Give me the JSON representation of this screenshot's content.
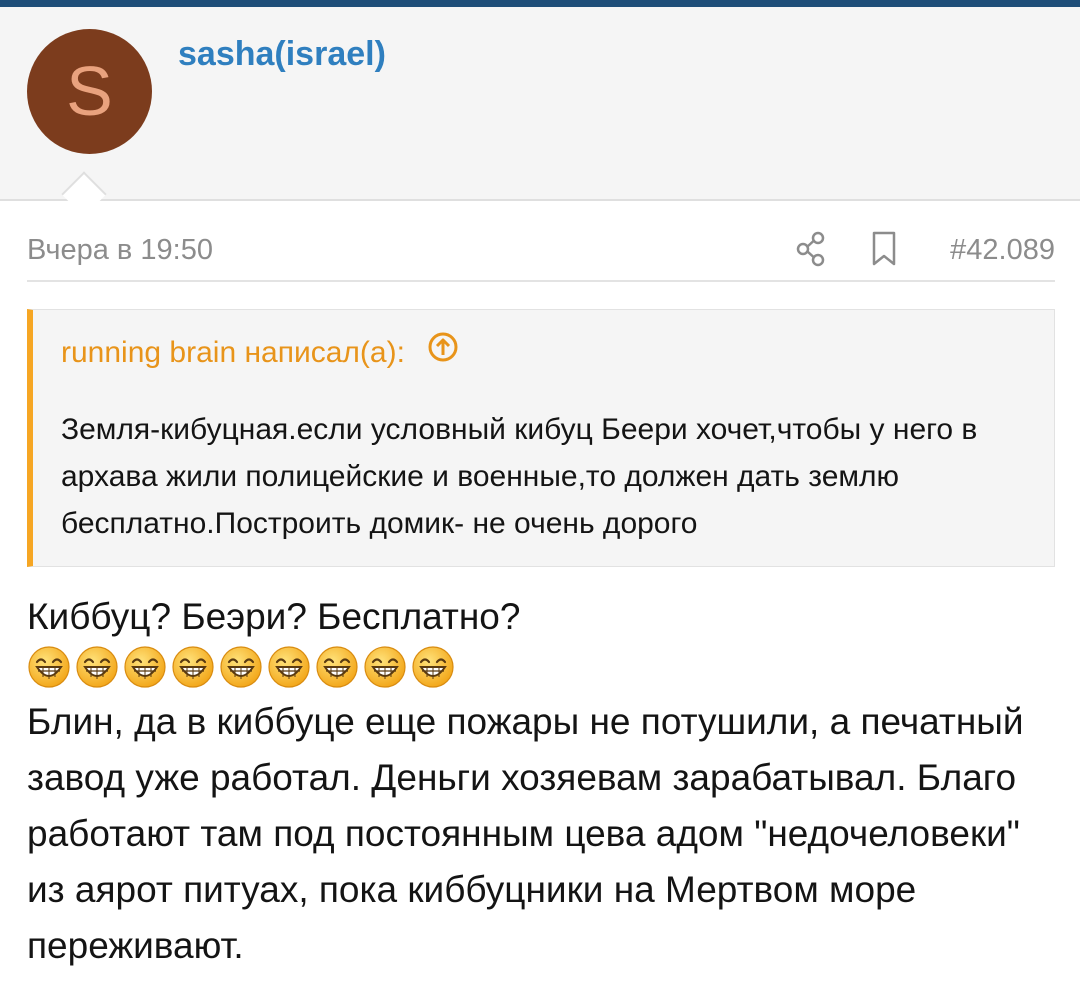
{
  "author": {
    "avatar_letter": "S",
    "name": "sasha(israel)"
  },
  "post": {
    "date": "Вчера в 19:50",
    "number": "#42.089",
    "share_icon": "share-icon",
    "bookmark_icon": "bookmark-icon"
  },
  "quote": {
    "author_line": "running brain написал(а):",
    "text": "Земля-кибуцная.если условный кибуц Беери хочет,чтобы у него в архава жили полицейские и военные,то должен дать землю бесплатно.Построить домик- не очень дорого"
  },
  "body": {
    "line1": "Киббуц? Беэри? Бесплатно?",
    "emoji_count": 9,
    "emoji_icon": "laughing-face-icon",
    "paragraph": "Блин, да в киббуце еще пожары не потушили, а печатный завод уже работал. Деньги хозяевам зарабатывал. Благо работают там под постоянным цева адом \"недочеловеки\" из аярот питуах, пока киббуцники на Мертвом море переживают."
  },
  "colors": {
    "accent_blue": "#2f7fbf",
    "quote_orange": "#f6a623",
    "avatar_bg": "#7c3c1d",
    "top_bar": "#1f4e79"
  }
}
